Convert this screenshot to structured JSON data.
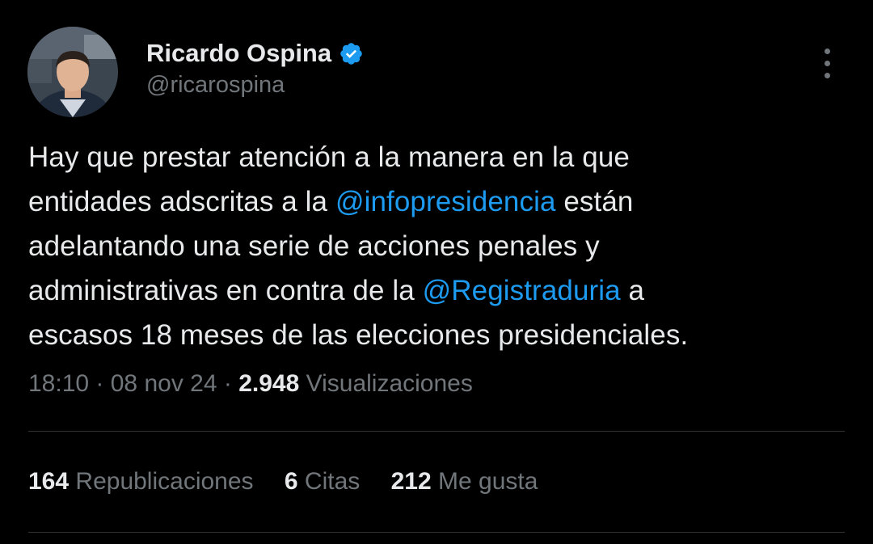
{
  "author": {
    "name": "Ricardo Ospina",
    "handle": "@ricarospina",
    "verified_color": "#1d9bf0"
  },
  "tweet": {
    "line1": "Hay que prestar atención a la manera en la que",
    "line2_pre": "entidades adscritas a la ",
    "line2_mention": "@infopresidencia",
    "line2_post": " están",
    "line3": "adelantando una serie de acciones penales y",
    "line4_pre": "administrativas en contra de la ",
    "line4_mention": "@Registraduria",
    "line4_post": " a",
    "line5": "escasos 18 meses de las elecciones presidenciales."
  },
  "meta": {
    "time": "18:10",
    "date": "08 nov 24",
    "views_count": "2.948",
    "views_label": "Visualizaciones",
    "separator": " · "
  },
  "stats": {
    "reposts_count": "164",
    "reposts_label": "Republicaciones",
    "quotes_count": "6",
    "quotes_label": "Citas",
    "likes_count": "212",
    "likes_label": "Me gusta"
  },
  "colors": {
    "background": "#000000",
    "text": "#e7e9ea",
    "muted": "#71767b",
    "link": "#1d9bf0",
    "divider": "#2f3336"
  },
  "icons": [
    "verified-badge-icon",
    "more-options-icon"
  ]
}
